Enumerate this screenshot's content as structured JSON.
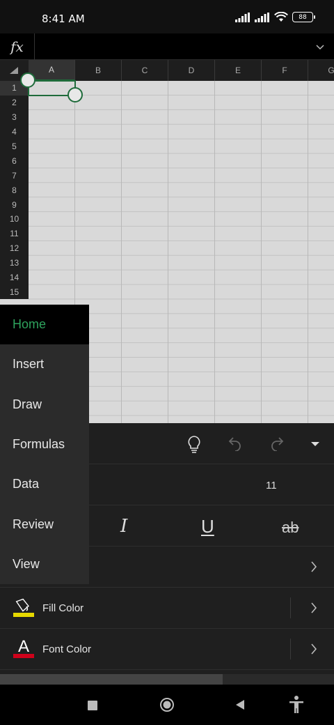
{
  "status_bar": {
    "time": "8:41 AM",
    "battery": "88"
  },
  "formula_bar": {
    "fx_label": "fx",
    "value": ""
  },
  "grid": {
    "columns": [
      "A",
      "B",
      "C",
      "D",
      "E",
      "F",
      "G"
    ],
    "rows": [
      "1",
      "2",
      "3",
      "4",
      "5",
      "6",
      "7",
      "8",
      "9",
      "10",
      "11",
      "12",
      "13",
      "14",
      "15"
    ],
    "selected_cell": "A1"
  },
  "ribbon": {
    "font_size": "11",
    "italic": "I",
    "underline": "U",
    "strikethrough": "ab",
    "fill_color_label": "Fill Color",
    "font_color_label": "Font Color",
    "font_color_glyph": "A",
    "fill_color_swatch": "#e6d800",
    "font_color_swatch": "#d0021b"
  },
  "tab_menu": {
    "items": [
      "Home",
      "Insert",
      "Draw",
      "Formulas",
      "Data",
      "Review",
      "View"
    ],
    "active": "Home"
  },
  "colors": {
    "accent": "#2ea35d",
    "selection": "#1e6b3a"
  }
}
